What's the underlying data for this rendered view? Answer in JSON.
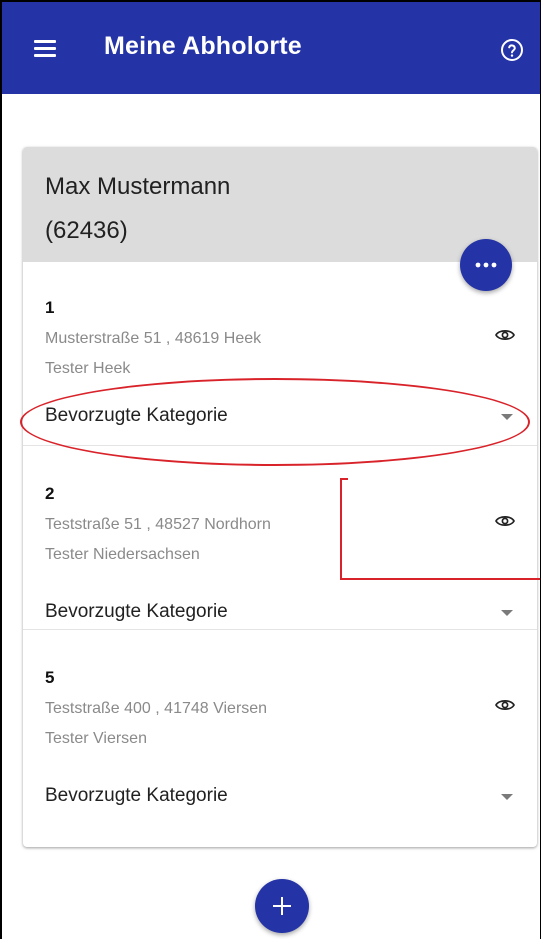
{
  "appbar": {
    "title": "Meine Abholorte",
    "menu_icon": "hamburger-menu-icon",
    "help_icon": "help-circle-icon"
  },
  "customer": {
    "name": "Max Mustermann",
    "number": "(62436)"
  },
  "more_button_icon": "more-horizontal-icon",
  "locations": [
    {
      "number": "1",
      "address": "Musterstraße 51 , 48619 Heek",
      "name": "Tester Heek",
      "category_label": "Bevorzugte Kategorie"
    },
    {
      "number": "2",
      "address": "Teststraße 51 , 48527 Nordhorn",
      "name": "Tester Niedersachsen",
      "category_label": "Bevorzugte Kategorie"
    },
    {
      "number": "5",
      "address": "Teststraße 400 , 41748 Viersen",
      "name": "Tester Viersen",
      "category_label": "Bevorzugte Kategorie"
    }
  ],
  "add_button_icon": "plus-icon",
  "colors": {
    "primary": "#2433a6",
    "header_bg": "#dcdcdc",
    "annotation": "#d9232a"
  }
}
